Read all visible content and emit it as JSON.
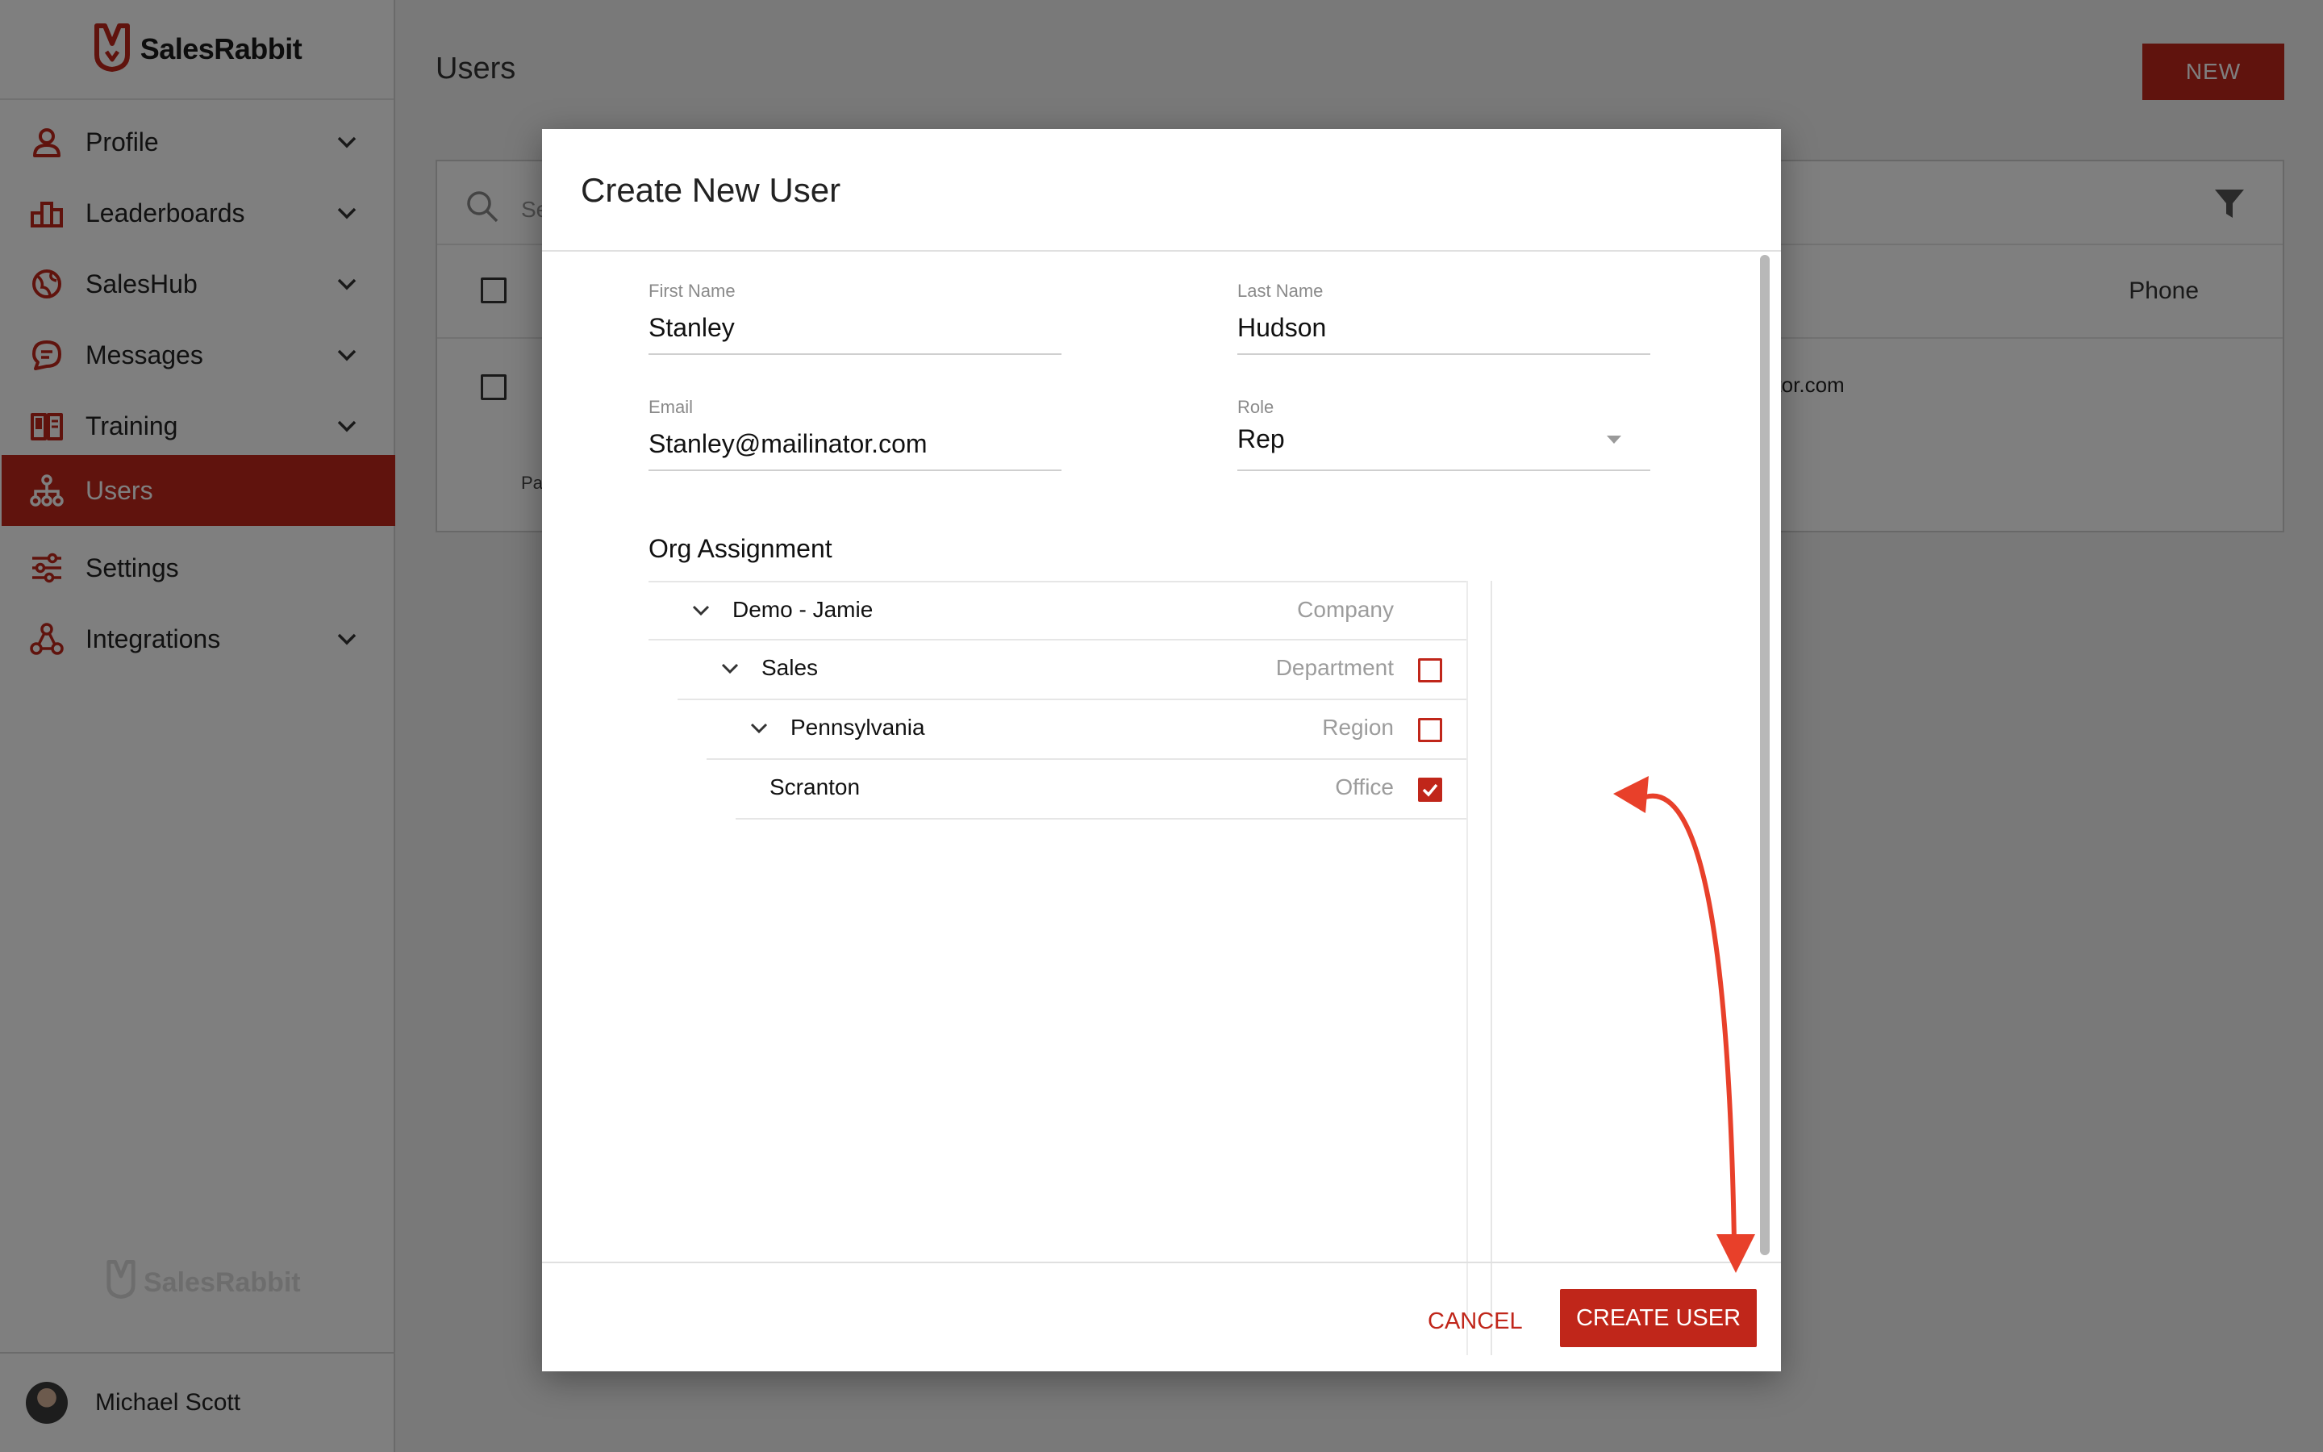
{
  "brand": {
    "name": "SalesRabbit"
  },
  "colors": {
    "accent": "#c0261a",
    "annotation": "#e8402a"
  },
  "sidebar": {
    "items": [
      {
        "label": "Profile",
        "icon": "person-icon",
        "expandable": true
      },
      {
        "label": "Leaderboards",
        "icon": "podium-icon",
        "expandable": true
      },
      {
        "label": "SalesHub",
        "icon": "globe-icon",
        "expandable": true
      },
      {
        "label": "Messages",
        "icon": "chat-icon",
        "expandable": true
      },
      {
        "label": "Training",
        "icon": "book-icon",
        "expandable": true
      },
      {
        "label": "Users",
        "icon": "org-chart-icon",
        "expandable": false,
        "active": true
      },
      {
        "label": "Settings",
        "icon": "sliders-icon",
        "expandable": false
      },
      {
        "label": "Integrations",
        "icon": "network-icon",
        "expandable": true
      }
    ],
    "footer_logo": "SalesRabbit",
    "user": {
      "name": "Michael Scott"
    }
  },
  "page": {
    "title": "Users",
    "new_button": "NEW",
    "search_placeholder_fragment": "Se",
    "column_phone": "Phone",
    "row_email_fragment": "ator.com",
    "pagination_fragment": "Pa"
  },
  "modal": {
    "title": "Create New User",
    "fields": {
      "first_name": {
        "label": "First Name",
        "value": "Stanley"
      },
      "last_name": {
        "label": "Last Name",
        "value": "Hudson"
      },
      "email": {
        "label": "Email",
        "value": "Stanley@mailinator.com"
      },
      "role": {
        "label": "Role",
        "value": "Rep"
      }
    },
    "org_title": "Org Assignment",
    "org_tree": [
      {
        "name": "Demo - Jamie",
        "type": "Company",
        "level": 0,
        "expanded": true,
        "checkbox": false
      },
      {
        "name": "Sales",
        "type": "Department",
        "level": 1,
        "expanded": true,
        "checkbox": true,
        "checked": false
      },
      {
        "name": "Pennsylvania",
        "type": "Region",
        "level": 2,
        "expanded": true,
        "checkbox": true,
        "checked": false
      },
      {
        "name": "Scranton",
        "type": "Office",
        "level": 3,
        "expanded": false,
        "checkbox": true,
        "checked": true
      }
    ],
    "cancel": "CANCEL",
    "create": "CREATE USER"
  }
}
